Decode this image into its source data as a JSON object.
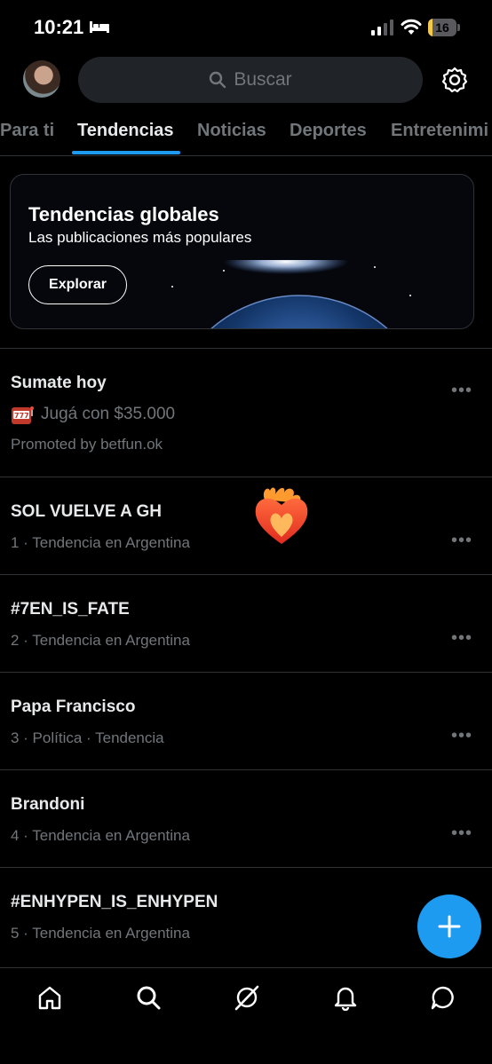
{
  "status_bar": {
    "time": "10:21",
    "battery": "16",
    "battery_level": 0.16
  },
  "search": {
    "placeholder": "Buscar"
  },
  "tabs": [
    {
      "label": "Para ti"
    },
    {
      "label": "Tendencias"
    },
    {
      "label": "Noticias"
    },
    {
      "label": "Deportes"
    },
    {
      "label": "Entretenimi"
    }
  ],
  "banner": {
    "title": "Tendencias globales",
    "subtitle": "Las publicaciones más populares",
    "button": "Explorar"
  },
  "promoted": {
    "title": "Sumate hoy",
    "line": "Jugá con $35.000",
    "by": "Promoted by betfun.ok"
  },
  "trends": [
    {
      "title": "SOL VUELVE A GH",
      "meta": "1 · Tendencia en Argentina"
    },
    {
      "title": "#7EN_IS_FATE",
      "meta": "2 · Tendencia en Argentina"
    },
    {
      "title": "Papa Francisco",
      "meta": "3 · Política · Tendencia"
    },
    {
      "title": "Brandoni",
      "meta": "4 · Tendencia en Argentina"
    },
    {
      "title": "#ENHYPEN_IS_ENHYPEN",
      "meta": "5 · Tendencia en Argentina"
    }
  ],
  "more": "•••",
  "colors": {
    "accent": "#1d9bf0",
    "background": "#000000",
    "muted": "#71767b"
  }
}
